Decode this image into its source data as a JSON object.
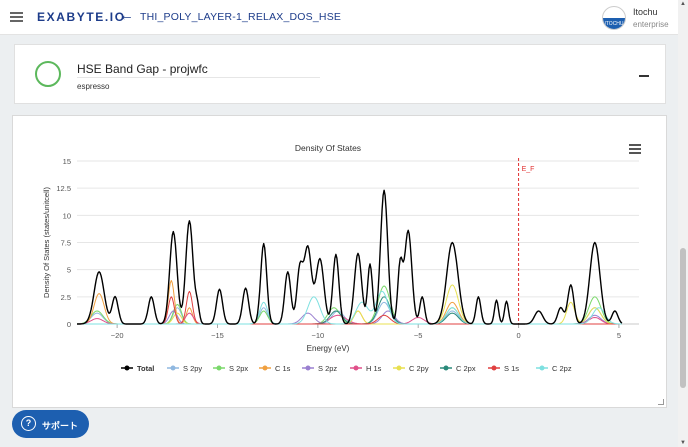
{
  "header": {
    "logo_text": "EXABYTE.IO",
    "job_title": "THI_POLY_LAYER-1_RELAX_DOS_HSE",
    "user_name": "Itochu",
    "user_plan": "enterprise",
    "avatar_text": "ITOCHU"
  },
  "unit": {
    "name": "HSE Band Gap - projwfc",
    "application": "espresso",
    "status_color": "#5cb85c"
  },
  "support": {
    "label": "サポート"
  },
  "chart_data": {
    "type": "line",
    "title": "Density Of States",
    "xlabel": "Energy (eV)",
    "ylabel": "Density Of States (states/unitcell)",
    "xlim": [
      -22,
      6
    ],
    "ylim": [
      0,
      15
    ],
    "x_ticks": [
      -20,
      -15,
      -10,
      -5,
      0,
      5
    ],
    "y_ticks": [
      0,
      2.5,
      5,
      7.5,
      10,
      12.5,
      15
    ],
    "fermi_label": "E_F",
    "fermi_x": 0,
    "grid": "horizontal",
    "legend_position": "bottom",
    "series": [
      {
        "name": "Total",
        "color": "#000000",
        "peaks": [
          [
            -20.9,
            4.8,
            0.25
          ],
          [
            -20.1,
            2.5,
            0.15
          ],
          [
            -18.3,
            2.5,
            0.15
          ],
          [
            -17.2,
            8.5,
            0.18
          ],
          [
            -16.4,
            9.5,
            0.18
          ],
          [
            -16.0,
            1.5,
            0.1
          ],
          [
            -14.9,
            3.2,
            0.15
          ],
          [
            -13.6,
            3.3,
            0.15
          ],
          [
            -12.7,
            7.4,
            0.15
          ],
          [
            -11.5,
            4.8,
            0.15
          ],
          [
            -10.9,
            5.0,
            0.15
          ],
          [
            -10.5,
            7.0,
            0.18
          ],
          [
            -9.9,
            6.0,
            0.2
          ],
          [
            -9.1,
            6.4,
            0.15
          ],
          [
            -8.0,
            6.5,
            0.18
          ],
          [
            -7.4,
            5.5,
            0.12
          ],
          [
            -6.7,
            12.3,
            0.18
          ],
          [
            -5.9,
            5.3,
            0.12
          ],
          [
            -5.5,
            8.6,
            0.18
          ],
          [
            -4.8,
            2.5,
            0.12
          ],
          [
            -3.3,
            7.5,
            0.28
          ],
          [
            -2.0,
            2.5,
            0.12
          ],
          [
            -1.1,
            2.2,
            0.1
          ],
          [
            -0.6,
            2.1,
            0.1
          ],
          [
            1.0,
            1.2,
            0.2
          ],
          [
            2.1,
            1.5,
            0.15
          ],
          [
            2.6,
            3.6,
            0.15
          ],
          [
            3.8,
            7.5,
            0.25
          ],
          [
            4.8,
            1.2,
            0.15
          ]
        ]
      },
      {
        "name": "S 2py",
        "color": "#90b8e0",
        "peaks": [
          [
            -21,
            1,
            0.3
          ],
          [
            -17,
            1.5,
            0.2
          ],
          [
            -12.7,
            1.5,
            0.2
          ],
          [
            -9,
            1.2,
            0.3
          ],
          [
            -6.7,
            2.0,
            0.3
          ],
          [
            -3.3,
            1.2,
            0.3
          ],
          [
            3.8,
            1.5,
            0.3
          ]
        ]
      },
      {
        "name": "S 2px",
        "color": "#7ad86a",
        "peaks": [
          [
            -21,
            1.2,
            0.3
          ],
          [
            -17,
            1.8,
            0.2
          ],
          [
            -12.7,
            1.2,
            0.2
          ],
          [
            -9.2,
            1.5,
            0.3
          ],
          [
            -6.7,
            3.5,
            0.3
          ],
          [
            -3.3,
            1.5,
            0.3
          ],
          [
            3.8,
            2.5,
            0.3
          ]
        ]
      },
      {
        "name": "C 1s",
        "color": "#f0a040",
        "peaks": [
          [
            -20.9,
            2.8,
            0.25
          ],
          [
            -17.3,
            4.0,
            0.15
          ],
          [
            -16.4,
            1.5,
            0.15
          ],
          [
            -8,
            1.2,
            0.2
          ],
          [
            -3.3,
            2.0,
            0.3
          ]
        ]
      },
      {
        "name": "S 2pz",
        "color": "#9a80d0",
        "peaks": [
          [
            -17.2,
            1.2,
            0.2
          ],
          [
            -10.5,
            1.0,
            0.3
          ],
          [
            -6.5,
            1.2,
            0.3
          ],
          [
            3.8,
            0.8,
            0.3
          ]
        ]
      },
      {
        "name": "H 1s",
        "color": "#e0508a",
        "peaks": [
          [
            -21,
            0.5,
            0.3
          ],
          [
            -16.4,
            1.0,
            0.2
          ],
          [
            -9,
            0.8,
            0.4
          ],
          [
            -5,
            0.6,
            0.3
          ],
          [
            3.8,
            0.6,
            0.3
          ]
        ]
      },
      {
        "name": "C 2py",
        "color": "#e8e050",
        "peaks": [
          [
            -17,
            1.0,
            0.2
          ],
          [
            -8,
            1.2,
            0.2
          ],
          [
            -3.3,
            3.6,
            0.3
          ],
          [
            2.6,
            2.0,
            0.2
          ],
          [
            3.8,
            1.5,
            0.3
          ]
        ]
      },
      {
        "name": "C 2px",
        "color": "#2a8a7a",
        "peaks": [
          [
            -9.1,
            1.2,
            0.3
          ],
          [
            -6.7,
            2.5,
            0.3
          ],
          [
            -3.3,
            1.0,
            0.3
          ]
        ]
      },
      {
        "name": "S 1s",
        "color": "#e04040",
        "peaks": [
          [
            -17.3,
            2.5,
            0.15
          ],
          [
            -16.4,
            3.0,
            0.15
          ],
          [
            -6.7,
            0.8,
            0.3
          ]
        ]
      },
      {
        "name": "C 2pz",
        "color": "#7ee0e0",
        "peaks": [
          [
            -12.7,
            2.0,
            0.2
          ],
          [
            -10.2,
            2.5,
            0.3
          ],
          [
            -7.8,
            2.0,
            0.3
          ],
          [
            -6.8,
            3.0,
            0.3
          ],
          [
            -3.3,
            1.5,
            0.3
          ],
          [
            4.0,
            1.5,
            0.3
          ]
        ]
      }
    ]
  }
}
